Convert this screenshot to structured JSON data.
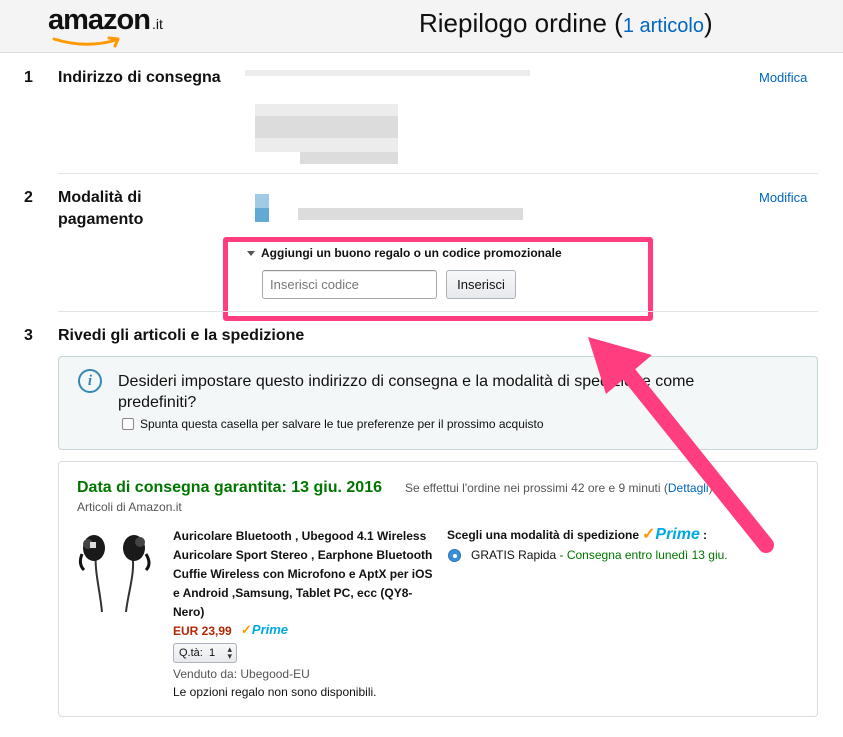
{
  "header": {
    "logo_word": "amazon",
    "logo_tld": ".it",
    "title": "Riepilogo ordine",
    "count_open": "(",
    "count_link": "1 articolo",
    "count_close": ")"
  },
  "steps": [
    {
      "num": "1",
      "title": "Indirizzo di consegna",
      "modify": "Modifica"
    },
    {
      "num": "2",
      "title_line1": "Modalità di",
      "title_line2": "pagamento",
      "modify": "Modifica"
    },
    {
      "num": "3",
      "title": "Rivedi gli articoli e la spedizione"
    }
  ],
  "promo": {
    "toggle": "Aggiungi un buono regalo o un codice promozionale",
    "placeholder": "Inserisci codice",
    "value": "",
    "button": "Inserisci"
  },
  "info": {
    "text": "Desideri impostare questo indirizzo di consegna e la modalità di spedizione come predefiniti?",
    "checkbox_label": "Spunta questa casella per salvare le tue preferenze per il prossimo acquisto",
    "checked": false
  },
  "order": {
    "delivery_date": "Data di consegna garantita: 13 giu. 2016",
    "delivery_condition": "Se effettui l'ordine nei prossimi 42 ore e 9 minuti",
    "details_open": "(",
    "details_link": "Dettagli",
    "details_close": ")",
    "seller_line": "Articoli di Amazon.it",
    "product_title": "Auricolare Bluetooth , Ubegood 4.1 Wireless Auricolare Sport Stereo , Earphone Bluetooth Cuffie Wireless con Microfono e AptX per iOS e Android ,Samsung, Tablet PC, ecc (QY8- Nero)",
    "price": "EUR 23,99",
    "qty_label": "Q.tà:",
    "qty_value": "1",
    "sold_by": "Venduto da: Ubegood-EU",
    "gift_note": "Le opzioni regalo non sono disponibili.",
    "shipping_title": "Scegli una modalità di spedizione",
    "shipping_colon": ":",
    "shipping_option_main": "GRATIS Rapida",
    "shipping_option_detail": "- Consegna entro lunedì 13 giu."
  },
  "prime": {
    "check": "✓",
    "word": "Prime"
  },
  "colors": {
    "highlight": "#ff3d7f",
    "link": "#0066c0",
    "green": "#007600",
    "price": "#b12704",
    "prime": "#00a8e1"
  }
}
